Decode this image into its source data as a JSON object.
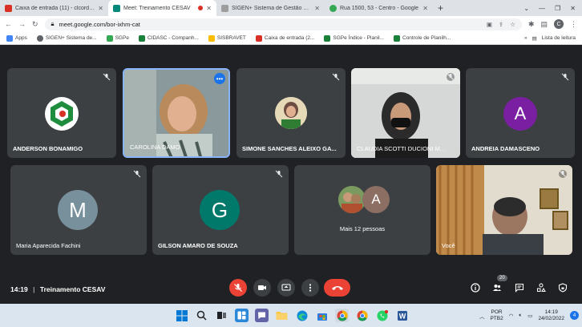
{
  "browser": {
    "tabs": [
      {
        "title": "Caixa de entrada (11) - clcorde...",
        "color": "#d93025",
        "active": false
      },
      {
        "title": "Meet: Treinamento CESAV",
        "color": "#00897b",
        "active": true
      },
      {
        "title": "SIGEN+ Sistema de Gestão da De",
        "color": "#9e9e9e",
        "active": false
      },
      {
        "title": "Rua 1500, 53 - Centro - Google",
        "color": "#34a853",
        "active": false
      }
    ],
    "new_tab": "+",
    "url": "meet.google.com/bor-ixhm-cat",
    "profile_initial": "C",
    "bookmarks": [
      {
        "label": "Apps",
        "color": "#4285f4"
      },
      {
        "label": "SIGEN+ Sistema de...",
        "color": "#5f6368"
      },
      {
        "label": "SGPe",
        "color": "#34a853"
      },
      {
        "label": "CIDASC - Companh...",
        "color": "#188038"
      },
      {
        "label": "SISBRAVET",
        "color": "#fbbc04"
      },
      {
        "label": "Caixa de entrada (2...",
        "color": "#d93025"
      },
      {
        "label": "SGPe Índice - Planil...",
        "color": "#188038"
      },
      {
        "label": "Controle de Planilh...",
        "color": "#188038"
      }
    ],
    "reading_list": "Lista de leitura"
  },
  "meet": {
    "participants": [
      {
        "name": "ANDERSON BONAMIGO"
      },
      {
        "name": "CAROLINA DAMO"
      },
      {
        "name": "SIMONE SANCHES ALEIXO GA..."
      },
      {
        "name": "CLAUDIA SCOTTI DUCIONI M..."
      },
      {
        "name": "ANDREIA DAMASCENO",
        "initial": "A",
        "color": "#7b1fa2"
      },
      {
        "name": "Maria Aparecida Fachini",
        "initial": "M",
        "color": "#78909c"
      },
      {
        "name": "GILSON AMARO DE SOUZA",
        "initial": "G",
        "color": "#00796b"
      },
      {
        "name": "Mais 12 pessoas",
        "initial": "A",
        "color": "#8d6e63"
      },
      {
        "name": "Você"
      }
    ],
    "time": "14:19",
    "meeting_name": "Treinamento CESAV",
    "people_count": "20"
  },
  "taskbar": {
    "lang_top": "POR",
    "lang_bottom": "PTB2",
    "time": "14:19",
    "date": "24/02/2022",
    "notifications": "4"
  }
}
